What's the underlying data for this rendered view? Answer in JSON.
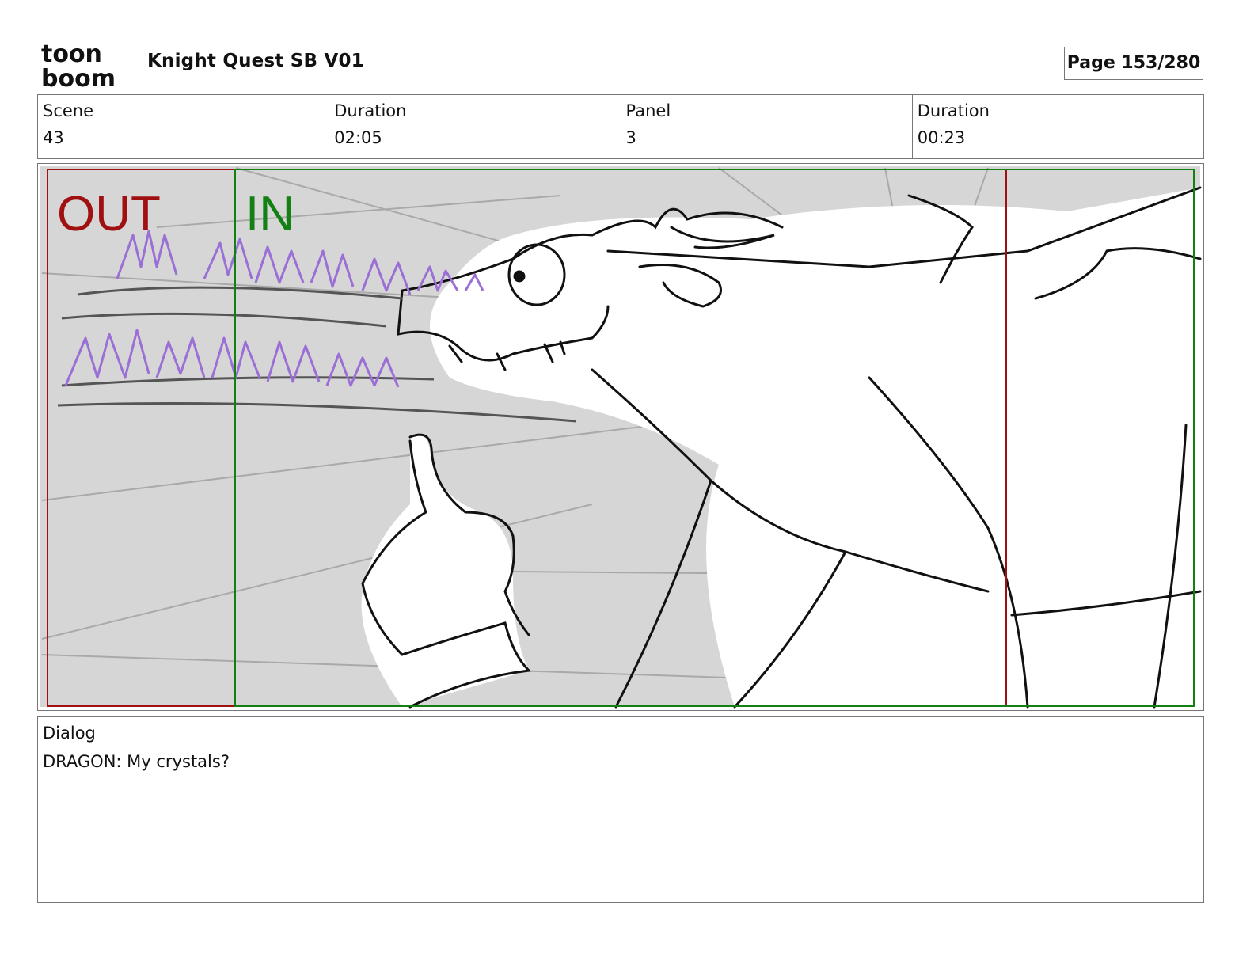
{
  "header": {
    "logo_text_line1": "toon",
    "logo_text_line2": "boom",
    "project_title": "Knight Quest SB V01",
    "page_indicator": "Page 153/280"
  },
  "info": {
    "scene_label": "Scene",
    "scene_value": "43",
    "scene_duration_label": "Duration",
    "scene_duration_value": "02:05",
    "panel_label": "Panel",
    "panel_value": "3",
    "panel_duration_label": "Duration",
    "panel_duration_value": "00:23"
  },
  "panel": {
    "out_marker": "OUT",
    "in_marker": "IN",
    "colors": {
      "out_frame": "#a01010",
      "in_frame": "#138013",
      "background": "#d6d6d6",
      "crystals": "#9b6fd6"
    }
  },
  "dialog": {
    "label": "Dialog",
    "text": "DRAGON: My crystals?"
  }
}
